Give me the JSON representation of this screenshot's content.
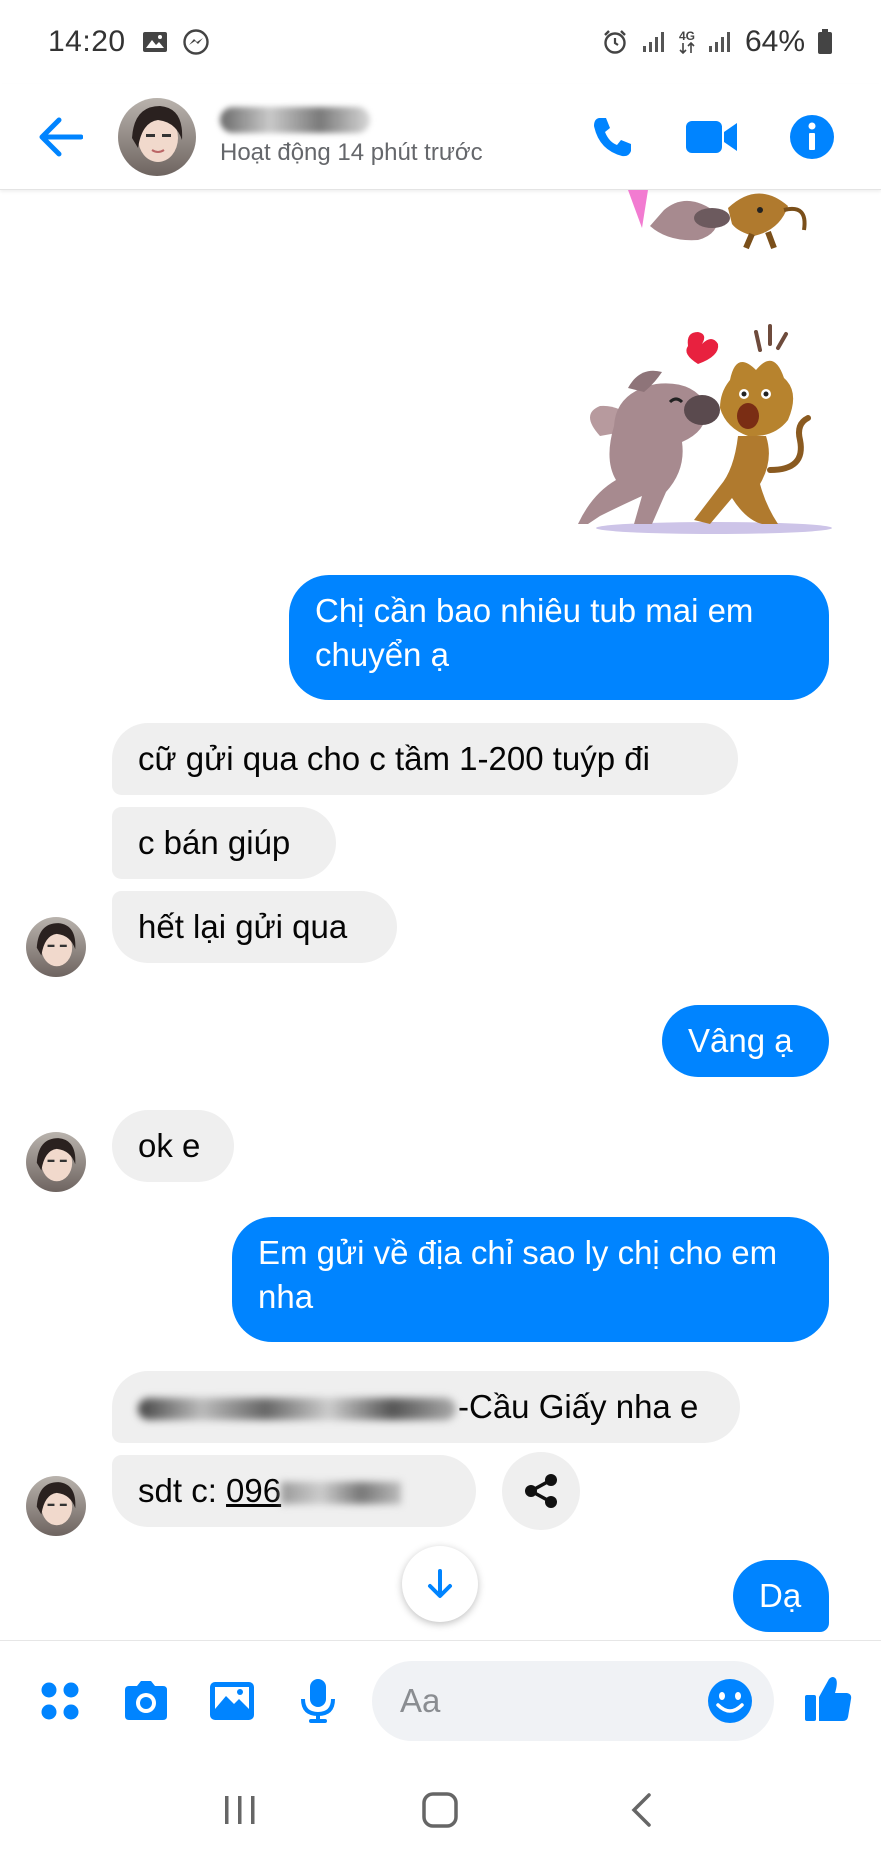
{
  "status_bar": {
    "time": "14:20",
    "network": "4G",
    "battery": "64%"
  },
  "header": {
    "contact_status": "Hoạt động 14 phút trước"
  },
  "messages": {
    "out_1": "Chị cần bao nhiêu tub mai em chuyển ạ",
    "in_1": "cữ gửi qua cho c tầm 1-200 tuýp đi",
    "in_2": "c bán giúp",
    "in_3": "hết lại gửi qua",
    "out_2": "Vâng ạ",
    "in_4": "ok e",
    "out_3": "Em gửi về địa chỉ sao ly chị cho em nha",
    "in_5_suffix": "-Cầu Giấy nha e",
    "in_6_prefix": "sdt c: ",
    "in_6_phone": "096",
    "out_4": "Dạ"
  },
  "composer": {
    "placeholder": "Aa"
  },
  "colors": {
    "accent": "#0084ff",
    "incoming_bubble": "#efefef",
    "outgoing_text": "#ffffff"
  },
  "icons": {
    "back": "arrow-left-icon",
    "call": "phone-icon",
    "video": "video-camera-icon",
    "info": "info-icon",
    "more": "four-dots-icon",
    "camera": "camera-icon",
    "gallery": "image-icon",
    "mic": "microphone-icon",
    "emoji": "smiley-icon",
    "like": "thumbs-up-icon",
    "share": "share-icon",
    "scroll_down": "arrow-down-icon"
  }
}
